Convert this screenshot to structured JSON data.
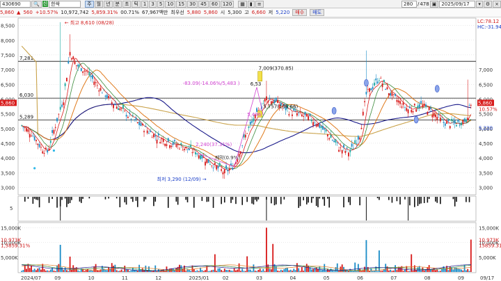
{
  "toolbar": {
    "code": "430690",
    "name": "한싹",
    "buttons": [
      "주",
      "월",
      "년",
      "분",
      "초",
      "틱",
      "1",
      "3",
      "5",
      "10",
      "15",
      "30",
      "45",
      "60",
      "120"
    ],
    "active_index": 0,
    "count": "280",
    "total": "478",
    "date": "2025/09/17"
  },
  "status": {
    "price": "5,860",
    "change": "560",
    "pct": "+10.57%",
    "volume": "10,972,742",
    "vol_pct": "5,859.31%",
    "turnover_pct": "00.71%",
    "amount_label": "67,967백만",
    "priority_label": "최우선",
    "bid": "5,880",
    "ask": "5,860",
    "open_label": "시",
    "open": "5,300",
    "high_label": "고",
    "high": "6,660",
    "low_label": "저",
    "low": "5,220",
    "sell_label": "매수",
    "buy_label": "매도"
  },
  "price_axis": {
    "ticks": [
      "8,500",
      "8,000",
      "7,500",
      "7,000",
      "6,500",
      "6,000",
      "5,500",
      "5,000",
      "4,500",
      "4,000",
      "3,500",
      "3,000"
    ],
    "right_ticks": [
      "7,000",
      "6,500",
      "6,000",
      "5,500",
      "5,000",
      "4,500",
      "4,000",
      "3,500",
      "3,000"
    ],
    "lc": "LC:78.12",
    "hc": "HC:-31.94",
    "right_price": "5,860",
    "right_pct": "10.57%",
    "right_low": "5,220"
  },
  "price_levels": {
    "top": "7,281",
    "mid": "6,030",
    "low": "5,289"
  },
  "annotations": {
    "high": "최고 8,610 (08/28)",
    "low": "최저 3,290 (12/09)",
    "box_label": "7,009(370.85)",
    "pct1": "-83.09(-14.06%/5,483 )",
    "pct2": "2,240(37.31%)",
    "pct3": "5,757(156.66)",
    "pct4": "6,53",
    "pct5": "5,496",
    "pct6": "퀘막(0.9%)"
  },
  "volume_axis": {
    "left_ticks": [
      "15,000K",
      "10,000K",
      "5,000K"
    ],
    "left_values": [
      "10,973K",
      "1,5859.31%"
    ],
    "right_ticks": [
      "15,000K",
      "10,000K",
      "5,000K"
    ],
    "right_values": [
      "10,973K",
      "15859.31"
    ],
    "sub_tick": "5"
  },
  "x_axis": [
    "2024/07",
    "09",
    "10",
    "11",
    "12",
    "2025/01",
    "02",
    "03",
    "04",
    "05",
    "06",
    "07",
    "08",
    "09",
    "09/17"
  ],
  "colors": {
    "up": "#d81c1c",
    "down": "#1d8ec8",
    "down_alt": "#19a9a0",
    "ma5": "#d81c1c",
    "ma20": "#e07a1c",
    "ma60": "#1a1a8a",
    "ma120": "#c9a24a",
    "magenta": "#d040d0",
    "hline": "#111111"
  }
}
